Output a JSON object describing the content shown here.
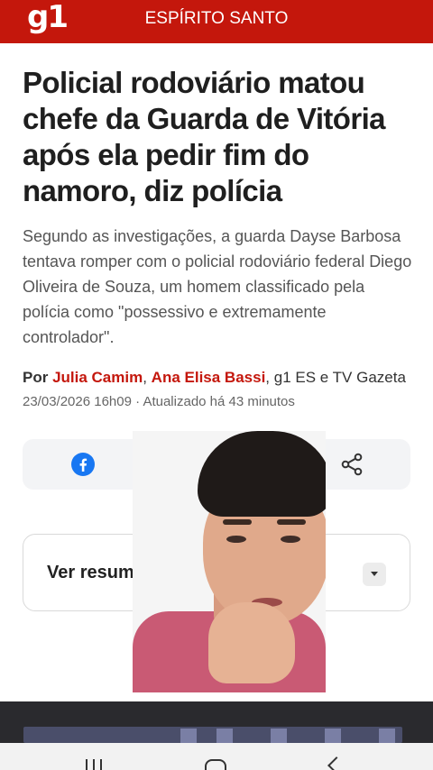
{
  "header": {
    "logo": "g1",
    "section": "ESPÍRITO SANTO",
    "brand_color": "#c4170c"
  },
  "article": {
    "headline": "Policial rodoviário matou chefe da Guarda de Vitória após ela pedir fim do namoro, diz polícia",
    "summary": "Segundo as investigações, a guarda Dayse Barbosa tentava romper com o policial rodoviário federal Diego Oliveira de Souza, um homem classificado pela polícia como \"possessivo e extremamente controlador\".",
    "byline": {
      "prefix": "Por ",
      "author1": "Julia Camim",
      "sep1": ", ",
      "author2": "Ana Elisa Bassi",
      "suffix": ", g1 ES e TV Gazeta"
    },
    "dateline": "23/03/2026 16h09 · Atualizado há 43 minutos"
  },
  "share": {
    "facebook_icon": "facebook-icon",
    "whatsapp_icon": "whatsapp-icon",
    "share_icon": "share-icon"
  },
  "resumo": {
    "label": "Ver resumo",
    "icon": "chevron-down-icon"
  },
  "navbar": {
    "icons": [
      "recent-apps-icon",
      "home-icon",
      "back-icon"
    ]
  }
}
